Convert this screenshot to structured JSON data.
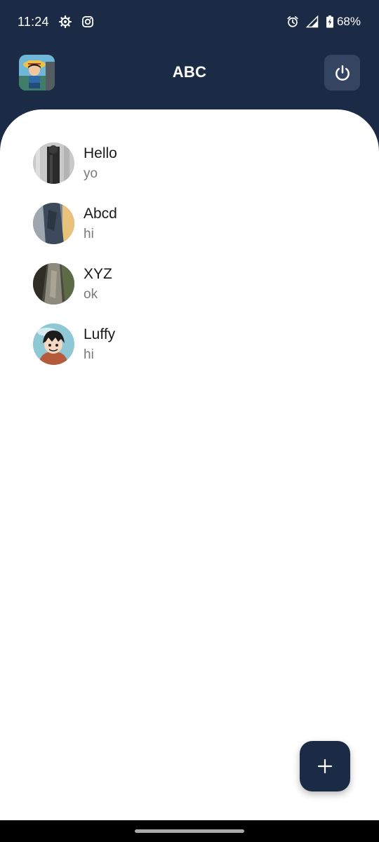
{
  "status_bar": {
    "time": "11:24",
    "left_icons": [
      "settings-gear-icon",
      "instagram-icon"
    ],
    "right_icons": [
      "alarm-icon",
      "signal-icon",
      "battery-icon"
    ],
    "battery": "68%"
  },
  "header": {
    "title": "ABC",
    "logo_icon": "app-logo-avatar",
    "power_icon": "power-icon"
  },
  "chats": [
    {
      "name": "Hello",
      "last_message": "yo"
    },
    {
      "name": "Abcd",
      "last_message": "hi"
    },
    {
      "name": "XYZ",
      "last_message": "ok"
    },
    {
      "name": "Luffy",
      "last_message": "hi"
    }
  ],
  "fab": {
    "icon": "plus-icon"
  },
  "colors": {
    "primary": "#1c2b45",
    "header_button": "#354461",
    "background": "#ffffff",
    "secondary_text": "#7a7a7a"
  }
}
